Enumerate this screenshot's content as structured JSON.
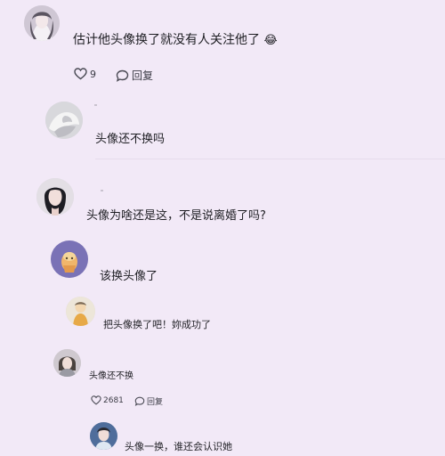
{
  "comments": [
    {
      "text": "估计他头像换了就没有人关注他了",
      "emoji": "😂",
      "likes": "9",
      "reply_label": "回复"
    },
    {
      "text": "头像还不换吗"
    },
    {
      "text": "头像为啥还是这，不是说离婚了吗?"
    },
    {
      "text": "该换头像了"
    },
    {
      "text": "把头像换了吧！妳成功了"
    },
    {
      "text": "头像还不换",
      "likes": "2681",
      "reply_label": "回复"
    },
    {
      "text": "头像一换，谁还会认识她"
    }
  ],
  "icons": {
    "like": "heart-icon",
    "reply": "comment-bubble-icon",
    "emoji": "laughing-emoji-icon"
  },
  "colors": {
    "background": "#f2e9f7",
    "text": "#1f1f24",
    "action_text": "#3b3b45"
  }
}
